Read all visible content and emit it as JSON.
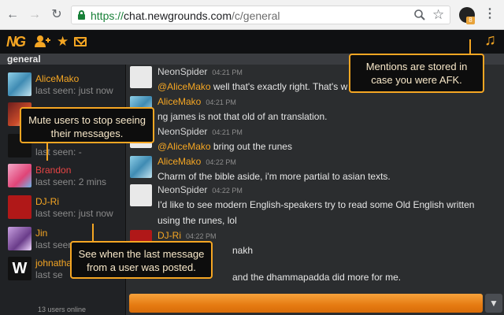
{
  "browser": {
    "url_scheme": "https://",
    "url_host": "chat.newgrounds.com",
    "url_path": "/c/general",
    "extension_badge": "8"
  },
  "app": {
    "logo": "NG",
    "channel": "general"
  },
  "users": [
    {
      "name": "AliceMako",
      "last_seen": "last seen: just now",
      "avatar": "ice-avatar"
    },
    {
      "name": "",
      "last_seen": "",
      "avatar": "red-avatar"
    },
    {
      "name": "",
      "last_seen": "last seen: -",
      "avatar": "black-avatar"
    },
    {
      "name": "Brandon",
      "last_seen": "last seen: 2 mins",
      "avatar": "pink-avatar",
      "muted": true
    },
    {
      "name": "DJ-Ri",
      "last_seen": "last seen: just now",
      "avatar": "djri-avatar"
    },
    {
      "name": "Jin",
      "last_seen": "last seen: just now",
      "avatar": "jin-avatar"
    },
    {
      "name": "johnatha",
      "last_seen": "last se",
      "avatar": "w-avatar"
    }
  ],
  "users_online": "13 users online",
  "messages": [
    {
      "name": "NeonSpider",
      "time": "04:21 PM",
      "mention": "@AliceMako",
      "text": " well that's exactly right.  That's w"
    },
    {
      "name": "AliceMako",
      "time": "04:21 PM",
      "mention": "",
      "text": "ng james is not that old of an translation."
    },
    {
      "name": "NeonSpider",
      "time": "04:21 PM",
      "mention": "@AliceMako",
      "text": " bring out the runes"
    },
    {
      "name": "AliceMako",
      "time": "04:22 PM",
      "mention": "",
      "text": "Charm of the bible aside, i'm more partial to asian texts."
    },
    {
      "name": "NeonSpider",
      "time": "04:22 PM",
      "mention": "",
      "text": "I'd like to see modern English-speakers try to read some Old English written",
      "text2": "using the runes, lol"
    },
    {
      "name": "DJ-Ri",
      "time": "04:22 PM",
      "mention": "",
      "text": "nakh"
    },
    {
      "name": "",
      "time": "",
      "mention": "",
      "text": "and the dhammapadda did more for me."
    }
  ],
  "callouts": {
    "mentions": "Mentions are stored in case you were AFK.",
    "mute": "Mute users to stop seeing their messages.",
    "last_message": "See when the last message from a user was posted."
  },
  "colors": {
    "accent": "#f5a623",
    "muted_user": "#e84545"
  }
}
